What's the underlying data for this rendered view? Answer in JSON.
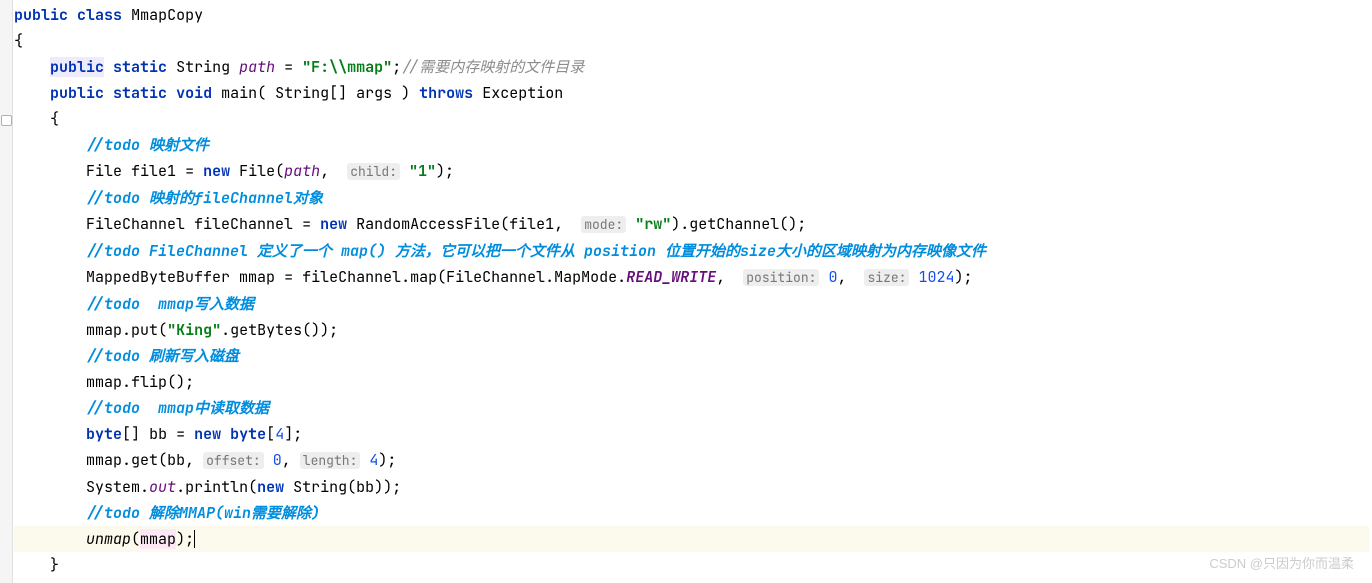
{
  "watermark": "CSDN @只因为你而温柔",
  "code": {
    "l1": {
      "kw_public": "public",
      "kw_class": "class",
      "class_name": "MmapCopy"
    },
    "l2": {
      "brace": "{"
    },
    "l3": {
      "kw_public": "public",
      "kw_static": "static",
      "type": "String",
      "field": "path",
      "eq": "=",
      "str": "\"F:\\\\mmap\"",
      "semi": ";",
      "comment": "//需要内存映射的文件目录"
    },
    "l4": {
      "kw_public": "public",
      "kw_static": "static",
      "kw_void": "void",
      "method": "main",
      "args": "( String[] args )",
      "kw_throws": "throws",
      "exc": "Exception"
    },
    "l5": {
      "brace": "{"
    },
    "l6": {
      "todo": "//todo 映射文件"
    },
    "l7": {
      "type": "File",
      "var": "file1",
      "eq": "=",
      "kw_new": "new",
      "ctor": "File",
      "arg1": "path",
      "hint1": "child:",
      "arg2": "\"1\"",
      "tail": ");"
    },
    "l8": {
      "todo": "//todo 映射的fileChannel对象"
    },
    "l9": {
      "type": "FileChannel",
      "var": "fileChannel",
      "eq": "=",
      "kw_new": "new",
      "ctor": "RandomAccessFile",
      "arg1": "file1",
      "hint1": "mode:",
      "arg2": "\"rw\"",
      "tail1": ").",
      "call": "getChannel",
      "tail2": "();"
    },
    "l10": {
      "todo": "//todo FileChannel 定义了一个 map() 方法，它可以把一个文件从 position 位置开始的size大小的区域映射为内存映像文件"
    },
    "l11": {
      "type": "MappedByteBuffer",
      "var": "mmap",
      "eq": "=",
      "obj": "fileChannel",
      "method": "map",
      "arg_enum1": "FileChannel.MapMode.",
      "arg_enum2": "READ_WRITE",
      "hint1": "position:",
      "arg2": "0",
      "hint2": "size:",
      "arg3": "1024",
      "tail": ");"
    },
    "l12": {
      "todo": "//todo  mmap写入数据"
    },
    "l13": {
      "obj": "mmap",
      "method": "put",
      "str": "\"King\"",
      "call": "getBytes",
      "tail": "());"
    },
    "l14": {
      "todo": "//todo 刷新写入磁盘"
    },
    "l15": {
      "obj": "mmap",
      "method": "flip",
      "tail": "();"
    },
    "l16": {
      "todo": "//todo  mmap中读取数据"
    },
    "l17": {
      "kw_byte": "byte",
      "brackets": "[]",
      "var": "bb",
      "eq": "=",
      "kw_new": "new",
      "type2": "byte",
      "size": "4",
      "tail": "];"
    },
    "l18": {
      "obj": "mmap",
      "method": "get",
      "arg1": "bb",
      "hint1": "offset:",
      "arg2": "0",
      "hint2": "length:",
      "arg3": "4",
      "tail": ");"
    },
    "l19": {
      "cls": "System",
      "field": "out",
      "method": "println",
      "kw_new": "new",
      "ctor": "String",
      "arg": "bb",
      "tail": "));"
    },
    "l20": {
      "todo": "//todo 解除MMAP(win需要解除)"
    },
    "l21": {
      "call": "unmap",
      "arg": "mmap",
      "tail": ");"
    },
    "l22": {
      "brace": "}"
    }
  }
}
